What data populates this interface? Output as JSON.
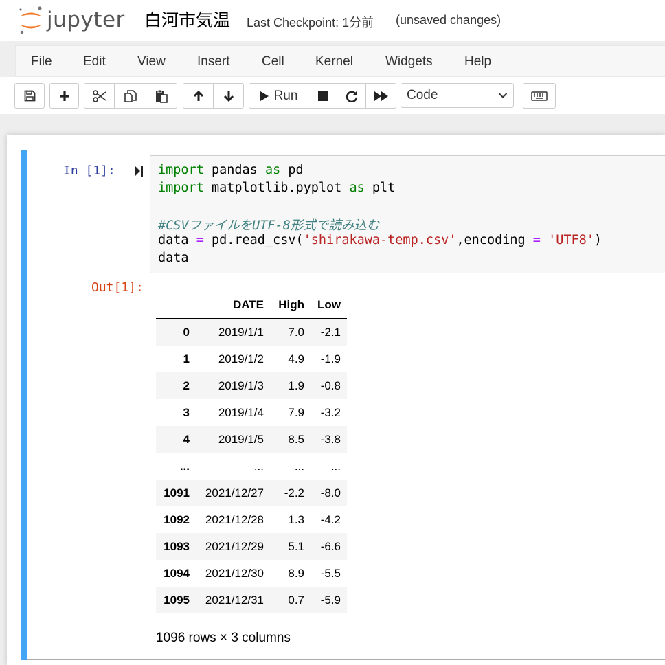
{
  "header": {
    "logo_text": "jupyter",
    "notebook_title": "白河市気温",
    "checkpoint": "Last Checkpoint: 1分前",
    "autosave_status": "(unsaved changes)"
  },
  "menu": {
    "items": [
      {
        "label": "File"
      },
      {
        "label": "Edit"
      },
      {
        "label": "View"
      },
      {
        "label": "Insert"
      },
      {
        "label": "Cell"
      },
      {
        "label": "Kernel"
      },
      {
        "label": "Widgets"
      },
      {
        "label": "Help"
      }
    ]
  },
  "toolbar": {
    "run_label": "Run",
    "cell_type": "Code",
    "icons": [
      "save-icon",
      "plus-icon",
      "scissors-icon",
      "copy-icon",
      "paste-icon",
      "arrow-up-icon",
      "arrow-down-icon",
      "run-icon",
      "stop-icon",
      "restart-icon",
      "fast-forward-icon",
      "keyboard-icon"
    ]
  },
  "cell": {
    "in_prompt": "In [1]:",
    "out_prompt": "Out[1]:",
    "code": {
      "l1": {
        "kw1": "import",
        "mod": " pandas ",
        "kw2": "as",
        "alias": " pd"
      },
      "l2": {
        "kw1": "import",
        "mod": " matplotlib.pyplot ",
        "kw2": "as",
        "alias": " plt"
      },
      "comment": "#CSVファイルをUTF-8形式で読み込む",
      "l4": {
        "a": "data ",
        "eq": "=",
        "b": " pd.read_csv(",
        "s1": "'shirakawa-temp.csv'",
        "c": ",encoding ",
        "eq2": "=",
        "d": " ",
        "s2": "'UTF8'",
        "e": ")"
      },
      "l5": "data"
    }
  },
  "dataframe": {
    "columns": [
      "DATE",
      "High",
      "Low"
    ],
    "rows": [
      {
        "idx": "0",
        "date": "2019/1/1",
        "high": "7.0",
        "low": "-2.1"
      },
      {
        "idx": "1",
        "date": "2019/1/2",
        "high": "4.9",
        "low": "-1.9"
      },
      {
        "idx": "2",
        "date": "2019/1/3",
        "high": "1.9",
        "low": "-0.8"
      },
      {
        "idx": "3",
        "date": "2019/1/4",
        "high": "7.9",
        "low": "-3.2"
      },
      {
        "idx": "4",
        "date": "2019/1/5",
        "high": "8.5",
        "low": "-3.8"
      },
      {
        "idx": "...",
        "date": "...",
        "high": "...",
        "low": "..."
      },
      {
        "idx": "1091",
        "date": "2021/12/27",
        "high": "-2.2",
        "low": "-8.0"
      },
      {
        "idx": "1092",
        "date": "2021/12/28",
        "high": "1.3",
        "low": "-4.2"
      },
      {
        "idx": "1093",
        "date": "2021/12/29",
        "high": "5.1",
        "low": "-6.6"
      },
      {
        "idx": "1094",
        "date": "2021/12/30",
        "high": "8.9",
        "low": "-5.5"
      },
      {
        "idx": "1095",
        "date": "2021/12/31",
        "high": "0.7",
        "low": "-5.9"
      }
    ],
    "dimensions": "1096 rows × 3 columns"
  },
  "colors": {
    "selected_cell_bar": "#42a5f5",
    "in_prompt": "#303f9f",
    "out_prompt": "#d84315",
    "keyword": "#008000",
    "string": "#ba2121",
    "comment": "#408080",
    "operator": "#aa22ff",
    "logo_orange": "#f37726"
  }
}
